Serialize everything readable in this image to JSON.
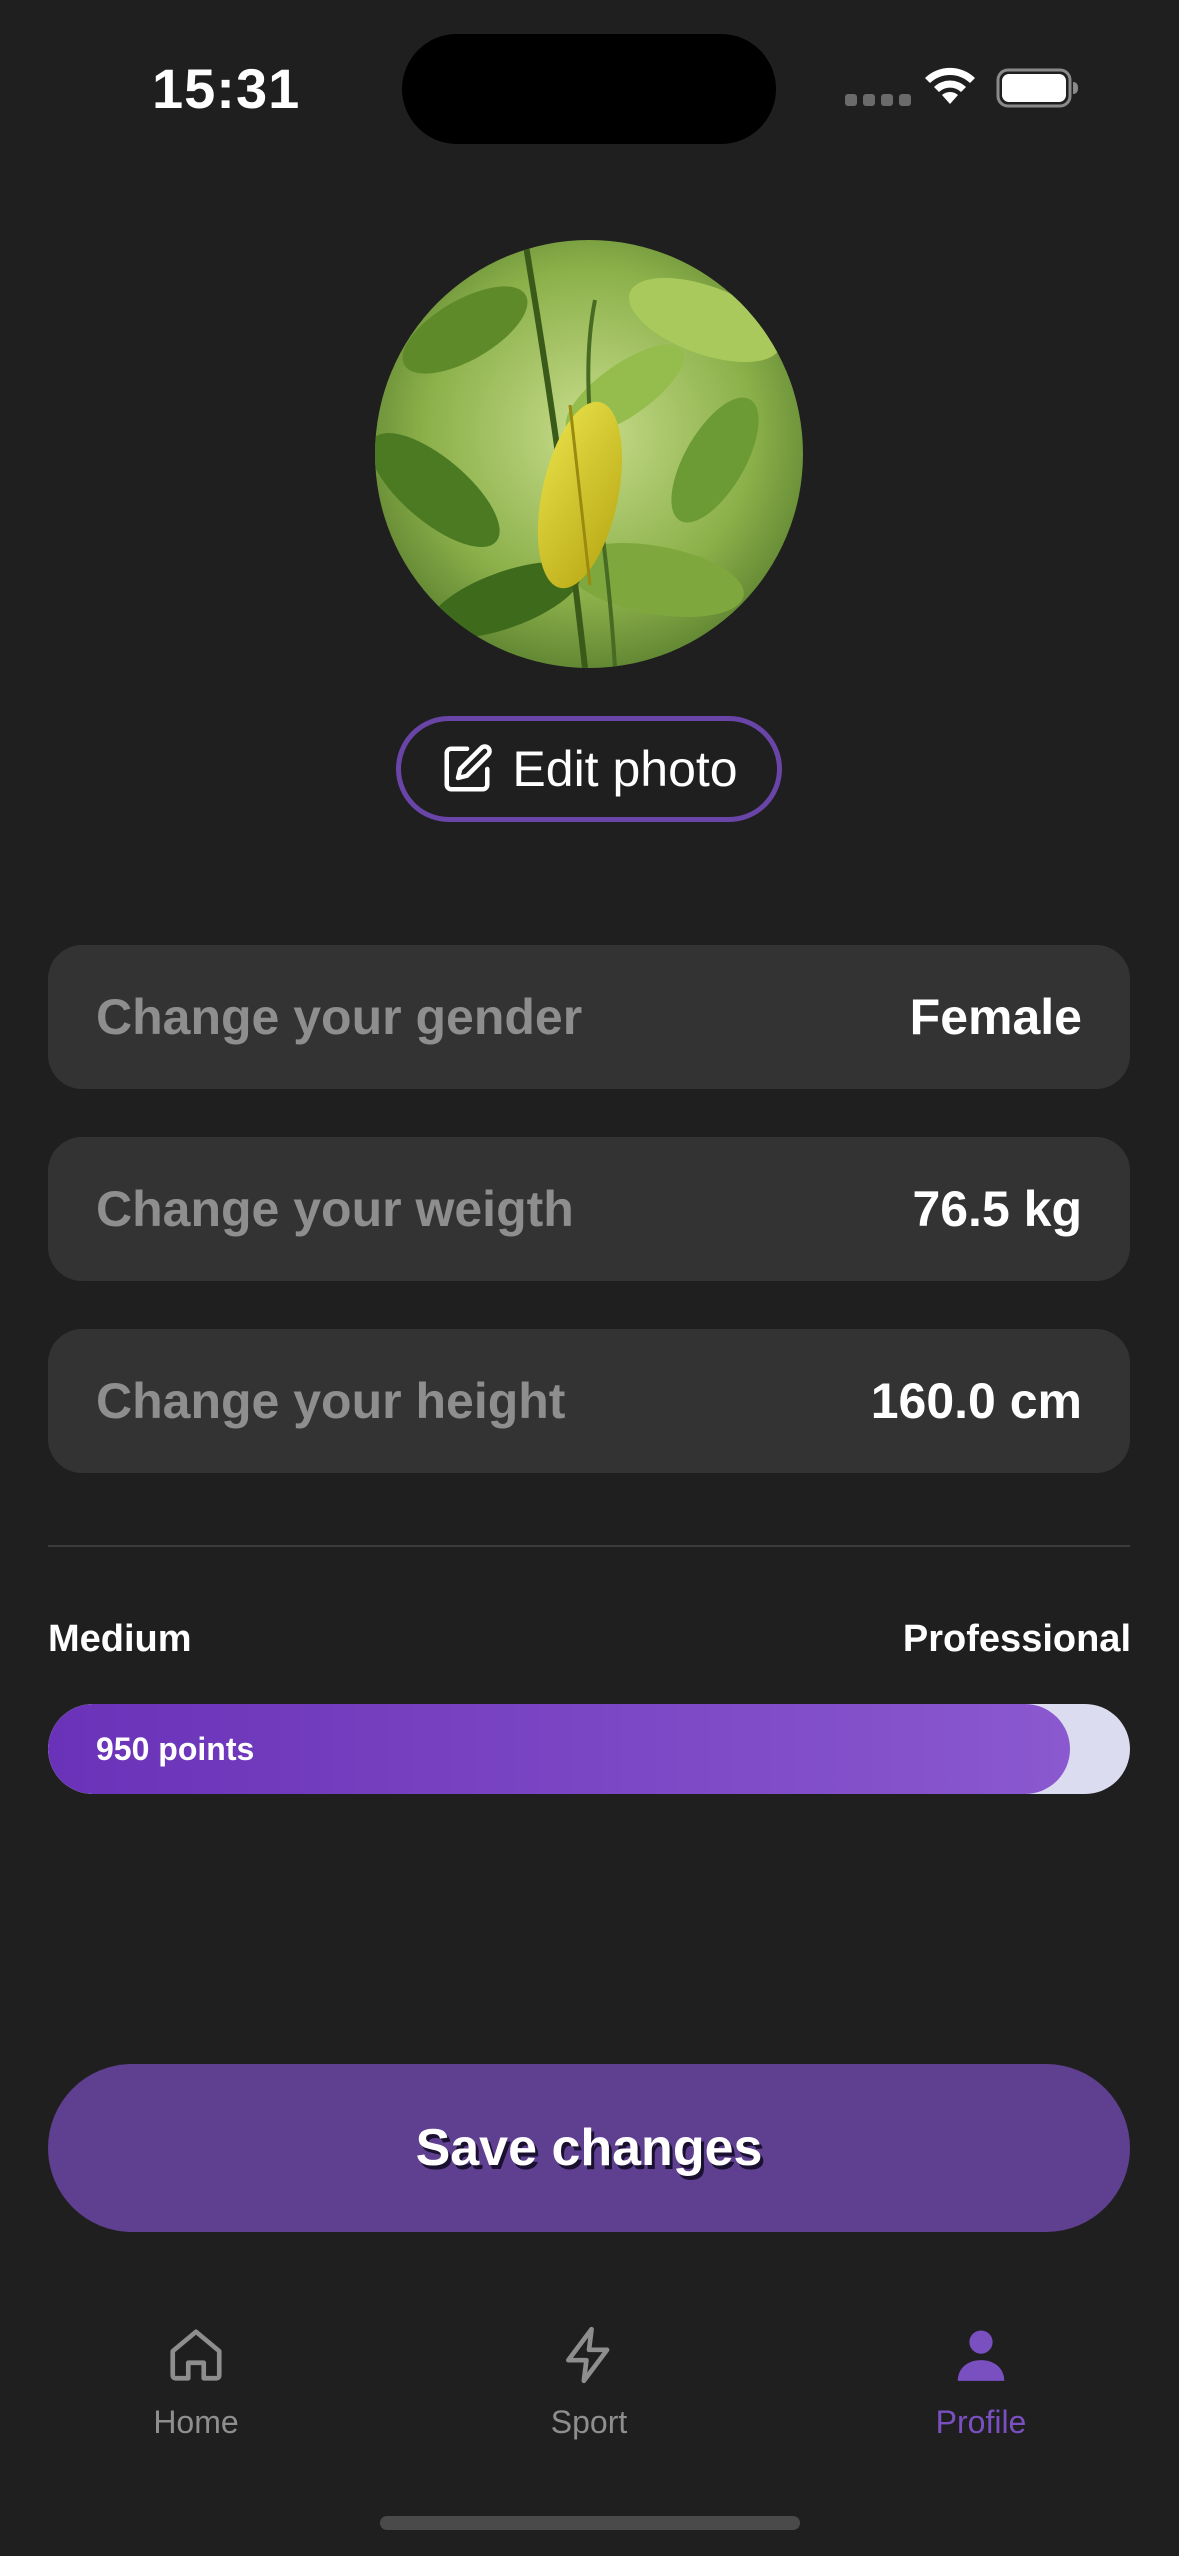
{
  "status_bar": {
    "time": "15:31"
  },
  "profile": {
    "avatar_alt": "Profile photo",
    "edit_photo_label": "Edit photo"
  },
  "settings": [
    {
      "label": "Change your gender",
      "value": "Female"
    },
    {
      "label": "Change your weigth",
      "value": "76.5 kg"
    },
    {
      "label": "Change your height",
      "value": "160.0 cm"
    }
  ],
  "level": {
    "current": "Medium",
    "next": "Professional",
    "points_label": "950 points",
    "progress_fraction": 0.945
  },
  "save_label": "Save changes",
  "tabs": [
    {
      "label": "Home",
      "icon": "home-icon",
      "active": false
    },
    {
      "label": "Sport",
      "icon": "lightning-icon",
      "active": false
    },
    {
      "label": "Profile",
      "icon": "person-icon",
      "active": true
    }
  ],
  "colors": {
    "accent": "#7a4fc0",
    "button": "#5e3f90",
    "background": "#1f1f1f",
    "row_background": "#333333"
  }
}
